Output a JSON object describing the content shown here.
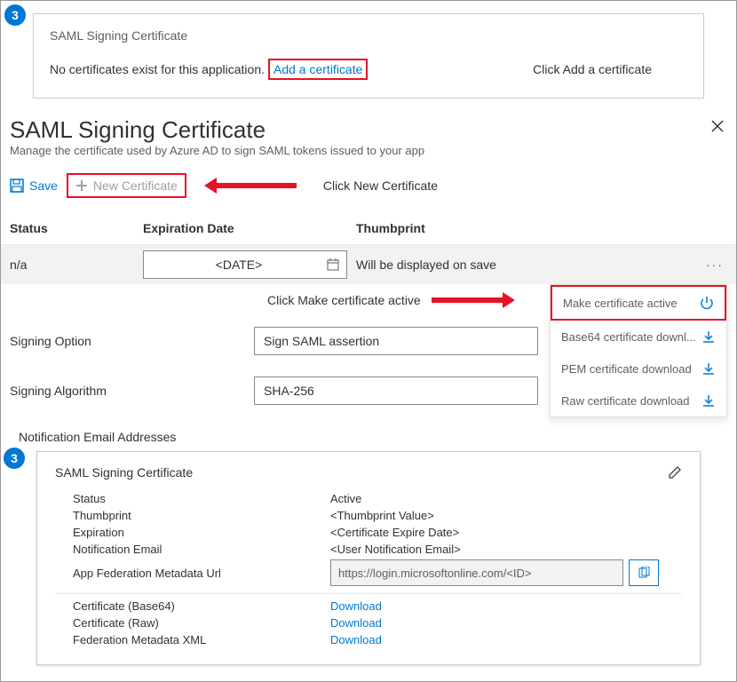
{
  "topCard": {
    "stepNumber": "3",
    "title": "SAML Signing Certificate",
    "emptyText": "No certificates exist for this application.",
    "addLink": "Add a certificate",
    "hint": "Click Add a certificate"
  },
  "panel": {
    "title": "SAML Signing Certificate",
    "subtitle": "Manage the certificate used by Azure AD to sign SAML tokens issued to your app"
  },
  "toolbar": {
    "save": "Save",
    "newCert": "New Certificate",
    "hint": "Click New Certificate"
  },
  "table": {
    "headers": {
      "status": "Status",
      "exp": "Expiration Date",
      "thumb": "Thumbprint"
    },
    "row": {
      "status": "n/a",
      "date": "<DATE>",
      "thumb": "Will be displayed on save"
    }
  },
  "contextMenu": {
    "hint": "Click Make certificate active",
    "items": {
      "active": "Make certificate active",
      "base64": "Base64 certificate downl...",
      "pem": "PEM certificate download",
      "raw": "Raw certificate download"
    }
  },
  "form": {
    "signingOptionLabel": "Signing Option",
    "signingOptionValue": "Sign SAML assertion",
    "signingAlgLabel": "Signing Algorithm",
    "signingAlgValue": "SHA-256",
    "notifLabel": "Notification Email Addresses"
  },
  "bottomCard": {
    "stepNumber": "3",
    "title": "SAML Signing Certificate",
    "rows": {
      "statusLabel": "Status",
      "statusValue": "Active",
      "thumbLabel": "Thumbprint",
      "thumbValue": "<Thumbprint Value>",
      "expLabel": "Expiration",
      "expValue": "<Certificate Expire Date>",
      "emailLabel": "Notification Email",
      "emailValue": "<User Notification Email>",
      "urlLabel": "App Federation Metadata Url",
      "urlValue": "https://login.microsoftonline.com/<ID>",
      "cert64Label": "Certificate (Base64)",
      "cert64Value": "Download",
      "certRawLabel": "Certificate (Raw)",
      "certRawValue": "Download",
      "fedLabel": "Federation Metadata XML",
      "fedValue": "Download"
    }
  }
}
